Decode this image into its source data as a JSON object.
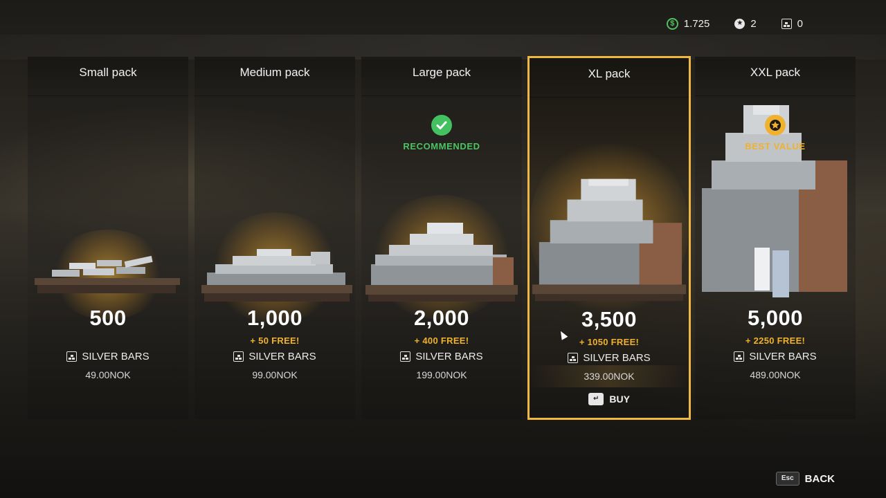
{
  "currencies": {
    "money": {
      "icon": "dollar-icon",
      "value": "1.725",
      "color": "#4ec060"
    },
    "points": {
      "icon": "star-coin-icon",
      "value": "2"
    },
    "silver_bars": {
      "icon": "silver-bars-icon",
      "value": "0"
    }
  },
  "packs": [
    {
      "title": "Small pack",
      "amount": "500",
      "bonus": "",
      "currency_label": "SILVER BARS",
      "price": "49.00NOK",
      "badge": null,
      "selected": false
    },
    {
      "title": "Medium pack",
      "amount": "1,000",
      "bonus": "+ 50 FREE!",
      "currency_label": "SILVER BARS",
      "price": "99.00NOK",
      "badge": null,
      "selected": false
    },
    {
      "title": "Large pack",
      "amount": "2,000",
      "bonus": "+ 400 FREE!",
      "currency_label": "SILVER BARS",
      "price": "199.00NOK",
      "badge": {
        "label": "RECOMMENDED",
        "icon": "checkmark-icon",
        "color": "#43c160"
      },
      "selected": false
    },
    {
      "title": "XL pack",
      "amount": "3,500",
      "bonus": "+ 1050 FREE!",
      "currency_label": "SILVER BARS",
      "price": "339.00NOK",
      "badge": null,
      "selected": true
    },
    {
      "title": "XXL pack",
      "amount": "5,000",
      "bonus": "+ 2250 FREE!",
      "currency_label": "SILVER BARS",
      "price": "489.00NOK",
      "badge": {
        "label": "BEST VALUE",
        "icon": "star-badge-icon",
        "color": "#f0b22e"
      },
      "selected": false
    }
  ],
  "buy": {
    "key": "↵",
    "label": "BUY"
  },
  "back": {
    "key": "Esc",
    "label": "BACK"
  },
  "colors": {
    "selected_border": "#f0b840",
    "bonus": "#f0b22e",
    "recommended": "#43c160"
  }
}
